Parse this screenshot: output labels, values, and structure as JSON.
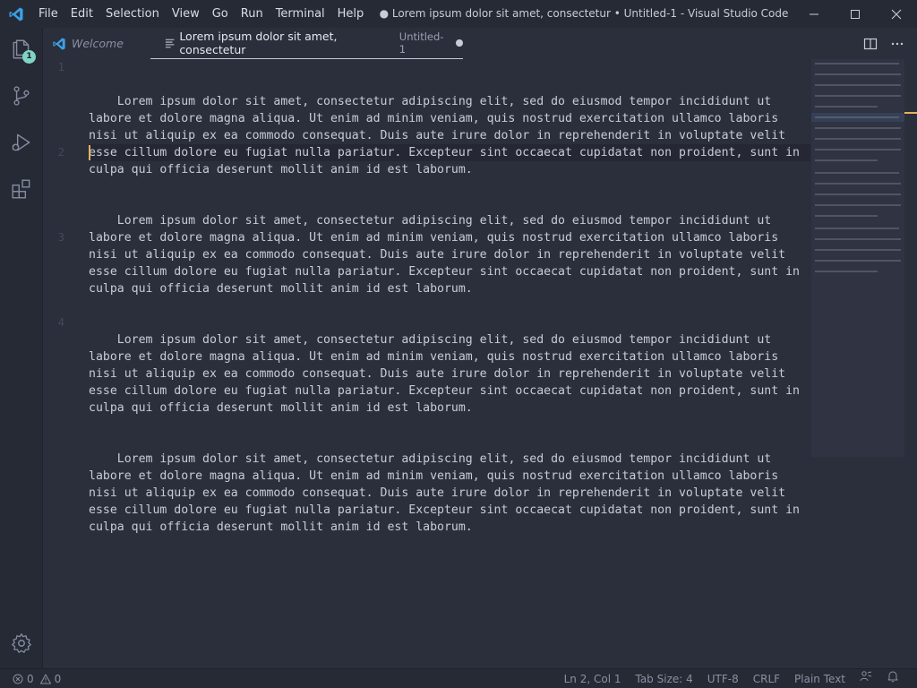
{
  "window": {
    "title": "● Lorem ipsum dolor sit amet, consectetur • Untitled-1 - Visual Studio Code",
    "menu": [
      "File",
      "Edit",
      "Selection",
      "View",
      "Go",
      "Run",
      "Terminal",
      "Help"
    ]
  },
  "activity_bar": {
    "items": [
      "explorer-icon",
      "source-control-icon",
      "run-debug-icon",
      "extensions-icon"
    ],
    "explorer_badge": "1",
    "bottom": "gear-icon"
  },
  "tabs": {
    "welcome_label": "Welcome",
    "active_label": "Lorem ipsum dolor sit amet, consectetur",
    "active_description": "Untitled-1"
  },
  "editor": {
    "line_numbers": [
      "1",
      "2",
      "3",
      "4"
    ],
    "lines": [
      "    Lorem ipsum dolor sit amet, consectetur adipiscing elit, sed do eiusmod tempor incididunt ut labore et dolore magna aliqua. Ut enim ad minim veniam, quis nostrud exercitation ullamco laboris nisi ut aliquip ex ea commodo consequat. Duis aute irure dolor in reprehenderit in voluptate velit esse cillum dolore eu fugiat nulla pariatur. Excepteur sint occaecat cupidatat non proident, sunt in culpa qui officia deserunt mollit anim id est laborum.",
      "    Lorem ipsum dolor sit amet, consectetur adipiscing elit, sed do eiusmod tempor incididunt ut labore et dolore magna aliqua. Ut enim ad minim veniam, quis nostrud exercitation ullamco laboris nisi ut aliquip ex ea commodo consequat. Duis aute irure dolor in reprehenderit in voluptate velit esse cillum dolore eu fugiat nulla pariatur. Excepteur sint occaecat cupidatat non proident, sunt in culpa qui officia deserunt mollit anim id est laborum.",
      "    Lorem ipsum dolor sit amet, consectetur adipiscing elit, sed do eiusmod tempor incididunt ut labore et dolore magna aliqua. Ut enim ad minim veniam, quis nostrud exercitation ullamco laboris nisi ut aliquip ex ea commodo consequat. Duis aute irure dolor in reprehenderit in voluptate velit esse cillum dolore eu fugiat nulla pariatur. Excepteur sint occaecat cupidatat non proident, sunt in culpa qui officia deserunt mollit anim id est laborum.",
      "    Lorem ipsum dolor sit amet, consectetur adipiscing elit, sed do eiusmod tempor incididunt ut labore et dolore magna aliqua. Ut enim ad minim veniam, quis nostrud exercitation ullamco laboris nisi ut aliquip ex ea commodo consequat. Duis aute irure dolor in reprehenderit in voluptate velit esse cillum dolore eu fugiat nulla pariatur. Excepteur sint occaecat cupidatat non proident, sunt in culpa qui officia deserunt mollit anim id est laborum."
    ]
  },
  "status_bar": {
    "errors": "0",
    "warnings": "0",
    "position": "Ln 2, Col 1",
    "tab_size": "Tab Size: 4",
    "encoding": "UTF-8",
    "eol": "CRLF",
    "language": "Plain Text"
  },
  "colors": {
    "background": "#2b2e3b",
    "chrome": "#262a35",
    "text": "#c8ccd8",
    "accent": "#7fd4c4",
    "cursor": "#e5b35a",
    "vscode_blue": "#3ba0e6"
  }
}
